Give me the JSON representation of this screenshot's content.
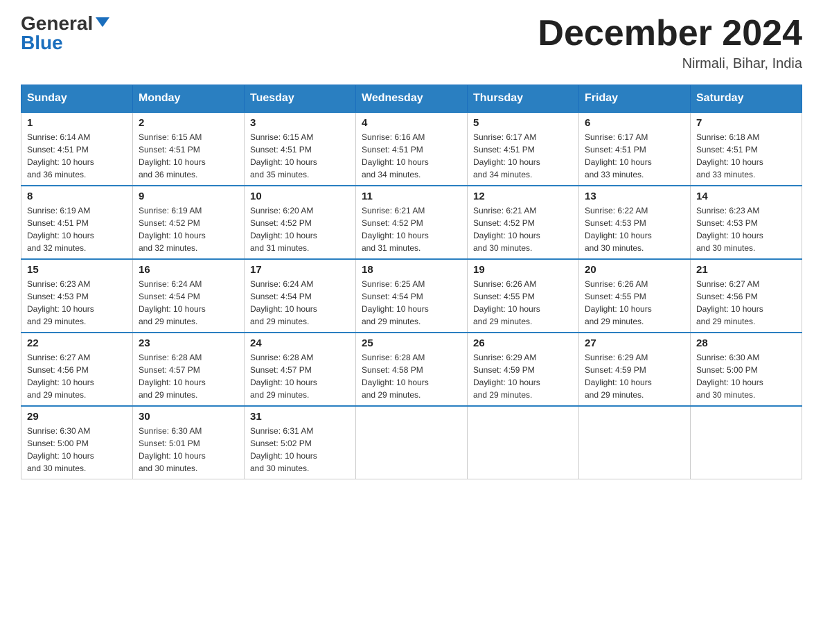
{
  "header": {
    "logo_general": "General",
    "logo_blue": "Blue",
    "month_title": "December 2024",
    "subtitle": "Nirmali, Bihar, India"
  },
  "days_of_week": [
    "Sunday",
    "Monday",
    "Tuesday",
    "Wednesday",
    "Thursday",
    "Friday",
    "Saturday"
  ],
  "weeks": [
    [
      {
        "day": "1",
        "sunrise": "6:14 AM",
        "sunset": "4:51 PM",
        "daylight": "10 hours and 36 minutes."
      },
      {
        "day": "2",
        "sunrise": "6:15 AM",
        "sunset": "4:51 PM",
        "daylight": "10 hours and 36 minutes."
      },
      {
        "day": "3",
        "sunrise": "6:15 AM",
        "sunset": "4:51 PM",
        "daylight": "10 hours and 35 minutes."
      },
      {
        "day": "4",
        "sunrise": "6:16 AM",
        "sunset": "4:51 PM",
        "daylight": "10 hours and 34 minutes."
      },
      {
        "day": "5",
        "sunrise": "6:17 AM",
        "sunset": "4:51 PM",
        "daylight": "10 hours and 34 minutes."
      },
      {
        "day": "6",
        "sunrise": "6:17 AM",
        "sunset": "4:51 PM",
        "daylight": "10 hours and 33 minutes."
      },
      {
        "day": "7",
        "sunrise": "6:18 AM",
        "sunset": "4:51 PM",
        "daylight": "10 hours and 33 minutes."
      }
    ],
    [
      {
        "day": "8",
        "sunrise": "6:19 AM",
        "sunset": "4:51 PM",
        "daylight": "10 hours and 32 minutes."
      },
      {
        "day": "9",
        "sunrise": "6:19 AM",
        "sunset": "4:52 PM",
        "daylight": "10 hours and 32 minutes."
      },
      {
        "day": "10",
        "sunrise": "6:20 AM",
        "sunset": "4:52 PM",
        "daylight": "10 hours and 31 minutes."
      },
      {
        "day": "11",
        "sunrise": "6:21 AM",
        "sunset": "4:52 PM",
        "daylight": "10 hours and 31 minutes."
      },
      {
        "day": "12",
        "sunrise": "6:21 AM",
        "sunset": "4:52 PM",
        "daylight": "10 hours and 30 minutes."
      },
      {
        "day": "13",
        "sunrise": "6:22 AM",
        "sunset": "4:53 PM",
        "daylight": "10 hours and 30 minutes."
      },
      {
        "day": "14",
        "sunrise": "6:23 AM",
        "sunset": "4:53 PM",
        "daylight": "10 hours and 30 minutes."
      }
    ],
    [
      {
        "day": "15",
        "sunrise": "6:23 AM",
        "sunset": "4:53 PM",
        "daylight": "10 hours and 29 minutes."
      },
      {
        "day": "16",
        "sunrise": "6:24 AM",
        "sunset": "4:54 PM",
        "daylight": "10 hours and 29 minutes."
      },
      {
        "day": "17",
        "sunrise": "6:24 AM",
        "sunset": "4:54 PM",
        "daylight": "10 hours and 29 minutes."
      },
      {
        "day": "18",
        "sunrise": "6:25 AM",
        "sunset": "4:54 PM",
        "daylight": "10 hours and 29 minutes."
      },
      {
        "day": "19",
        "sunrise": "6:26 AM",
        "sunset": "4:55 PM",
        "daylight": "10 hours and 29 minutes."
      },
      {
        "day": "20",
        "sunrise": "6:26 AM",
        "sunset": "4:55 PM",
        "daylight": "10 hours and 29 minutes."
      },
      {
        "day": "21",
        "sunrise": "6:27 AM",
        "sunset": "4:56 PM",
        "daylight": "10 hours and 29 minutes."
      }
    ],
    [
      {
        "day": "22",
        "sunrise": "6:27 AM",
        "sunset": "4:56 PM",
        "daylight": "10 hours and 29 minutes."
      },
      {
        "day": "23",
        "sunrise": "6:28 AM",
        "sunset": "4:57 PM",
        "daylight": "10 hours and 29 minutes."
      },
      {
        "day": "24",
        "sunrise": "6:28 AM",
        "sunset": "4:57 PM",
        "daylight": "10 hours and 29 minutes."
      },
      {
        "day": "25",
        "sunrise": "6:28 AM",
        "sunset": "4:58 PM",
        "daylight": "10 hours and 29 minutes."
      },
      {
        "day": "26",
        "sunrise": "6:29 AM",
        "sunset": "4:59 PM",
        "daylight": "10 hours and 29 minutes."
      },
      {
        "day": "27",
        "sunrise": "6:29 AM",
        "sunset": "4:59 PM",
        "daylight": "10 hours and 29 minutes."
      },
      {
        "day": "28",
        "sunrise": "6:30 AM",
        "sunset": "5:00 PM",
        "daylight": "10 hours and 30 minutes."
      }
    ],
    [
      {
        "day": "29",
        "sunrise": "6:30 AM",
        "sunset": "5:00 PM",
        "daylight": "10 hours and 30 minutes."
      },
      {
        "day": "30",
        "sunrise": "6:30 AM",
        "sunset": "5:01 PM",
        "daylight": "10 hours and 30 minutes."
      },
      {
        "day": "31",
        "sunrise": "6:31 AM",
        "sunset": "5:02 PM",
        "daylight": "10 hours and 30 minutes."
      },
      null,
      null,
      null,
      null
    ]
  ],
  "labels": {
    "sunrise": "Sunrise:",
    "sunset": "Sunset:",
    "daylight": "Daylight:"
  }
}
